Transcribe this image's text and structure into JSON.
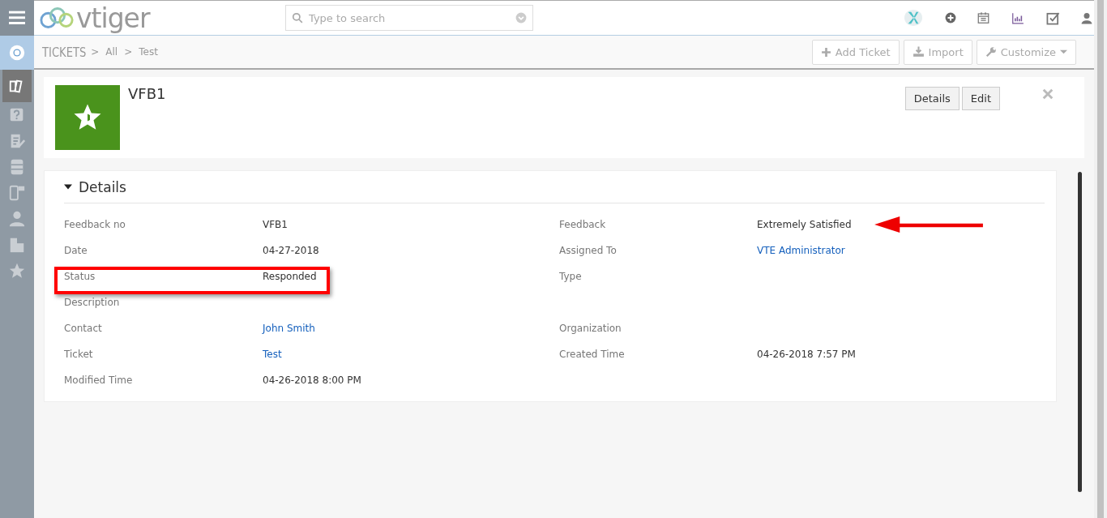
{
  "app": {
    "logo_text": "vtiger",
    "search": {
      "placeholder": "Type to search"
    }
  },
  "sidebar": {
    "items": [
      {
        "kind": "support",
        "selected": false
      },
      {
        "kind": "tickets",
        "selected": true
      },
      {
        "kind": "faq",
        "selected": false
      },
      {
        "kind": "notes",
        "selected": false
      },
      {
        "kind": "cabinet",
        "selected": false
      },
      {
        "kind": "phone",
        "selected": false
      },
      {
        "kind": "person",
        "selected": false
      },
      {
        "kind": "building",
        "selected": false
      },
      {
        "kind": "star",
        "selected": false
      }
    ]
  },
  "breadcrumb": {
    "module": "TICKETS",
    "separators": [
      ">",
      ">"
    ],
    "items": [
      "All",
      "Test"
    ]
  },
  "actions": [
    {
      "kind": "add",
      "label": "Add Ticket"
    },
    {
      "kind": "import",
      "label": "Import"
    },
    {
      "kind": "customize",
      "label": "Customize"
    }
  ],
  "record": {
    "title": "VFB1",
    "buttons": [
      "Details",
      "Edit"
    ]
  },
  "details": {
    "title": "Details",
    "expanded": true,
    "fields": [
      {
        "label": "Feedback no",
        "value": "VFB1",
        "kind": "text",
        "highlighted": false,
        "arrow": false
      },
      {
        "label": "Feedback",
        "value": "Extremely Satisfied",
        "kind": "text",
        "highlighted": false,
        "arrow": true
      },
      {
        "label": "Date",
        "value": "04-27-2018",
        "kind": "text",
        "highlighted": false,
        "arrow": false
      },
      {
        "label": "Assigned To",
        "value": "VTE Administrator",
        "kind": "link",
        "highlighted": false,
        "arrow": false
      },
      {
        "label": "Status",
        "value": "Responded",
        "kind": "text",
        "highlighted": true,
        "arrow": false
      },
      {
        "label": "Type",
        "kind": "text",
        "highlighted": false,
        "arrow": false
      },
      {
        "label": "Description",
        "kind": "text",
        "highlighted": false,
        "arrow": false
      },
      {
        "kind": "empty"
      },
      {
        "label": "Contact",
        "value": "John Smith",
        "kind": "link",
        "highlighted": false,
        "arrow": false
      },
      {
        "label": "Organization",
        "kind": "text",
        "highlighted": false,
        "arrow": false
      },
      {
        "label": "Ticket",
        "value": "Test",
        "kind": "link",
        "highlighted": false,
        "arrow": false
      },
      {
        "label": "Created Time",
        "value": "04-26-2018 7:57 PM",
        "kind": "text",
        "highlighted": false,
        "arrow": false
      },
      {
        "label": "Modified Time",
        "value": "04-26-2018 8:00 PM",
        "kind": "text",
        "highlighted": false,
        "arrow": false
      }
    ]
  }
}
